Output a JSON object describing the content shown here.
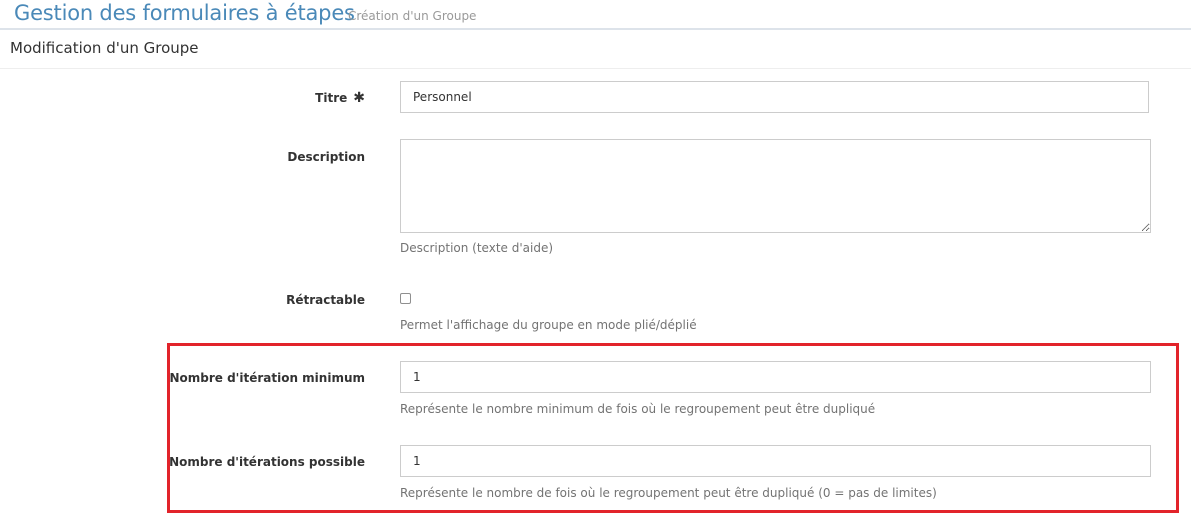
{
  "header": {
    "title": "Gestion des formulaires à étapes",
    "subtitle": "Création d'un Groupe"
  },
  "panel": {
    "title": "Modification d'un Groupe"
  },
  "form": {
    "titre": {
      "label": "Titre",
      "required_icon": "asterisk-icon",
      "value": "Personnel"
    },
    "description": {
      "label": "Description",
      "value": "",
      "help": "Description (texte d'aide)"
    },
    "retractable": {
      "label": "Rétractable",
      "checked": false,
      "help": "Permet l'affichage du groupe en mode plié/déplié"
    },
    "iteration_min": {
      "label": "Nombre d'itération minimum",
      "value": "1",
      "help": "Représente le nombre minimum de fois où le regroupement peut être dupliqué"
    },
    "iterations_possible": {
      "label": "Nombre d'itérations possible",
      "value": "1",
      "help": "Représente le nombre de fois où le regroupement peut être dupliqué (0 = pas de limites)"
    }
  },
  "colors": {
    "title": "#4a89b8",
    "highlight": "#e2232a",
    "help_text": "#737373",
    "border": "#cccccc"
  }
}
